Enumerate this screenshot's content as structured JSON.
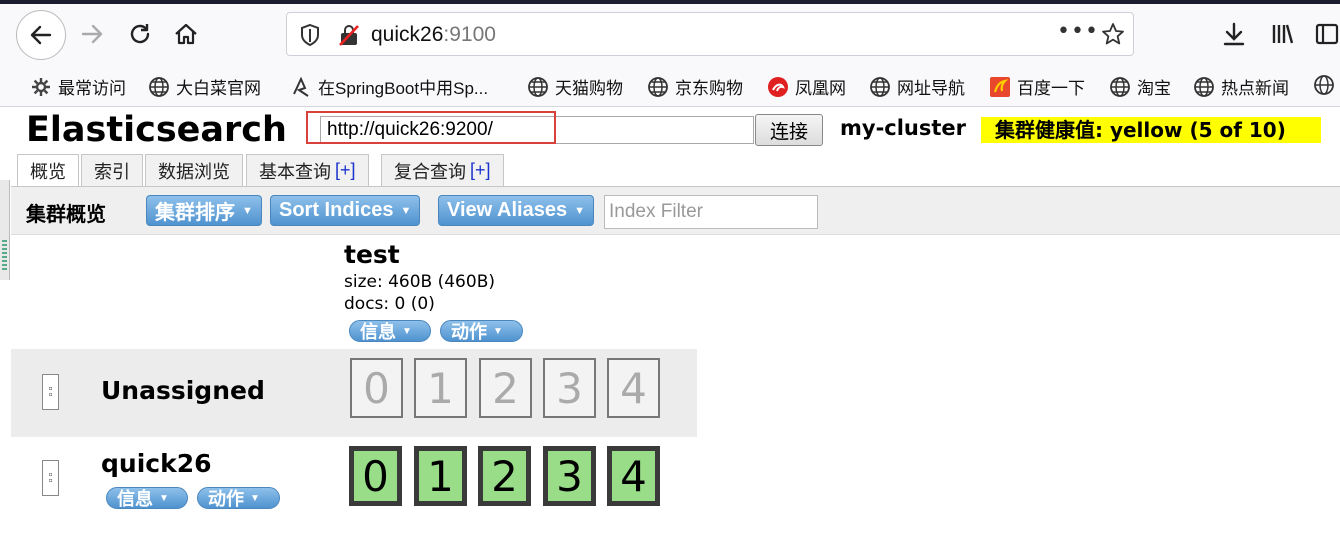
{
  "browser": {
    "url_host": "quick26",
    "url_port": ":9100",
    "bookmarks": [
      {
        "label": "最常访问",
        "icon": "gear-icon"
      },
      {
        "label": "大白菜官网",
        "icon": "globe-icon"
      },
      {
        "label": "在SpringBoot中用Sp...",
        "icon": "doc-icon"
      },
      {
        "label": "天猫购物",
        "icon": "globe-icon"
      },
      {
        "label": "京东购物",
        "icon": "globe-icon"
      },
      {
        "label": "凤凰网",
        "icon": "phoenix-icon"
      },
      {
        "label": "网址导航",
        "icon": "globe-icon"
      },
      {
        "label": "百度一下",
        "icon": "baidu-icon"
      },
      {
        "label": "淘宝",
        "icon": "globe-icon"
      },
      {
        "label": "热点新闻",
        "icon": "globe-icon"
      }
    ]
  },
  "header": {
    "title": "Elasticsearch",
    "connection_url": "http://quick26:9200/",
    "connect_label": "连接",
    "cluster_name": "my-cluster",
    "health": "集群健康值: yellow (5 of 10)",
    "health_color": "#ffff00"
  },
  "tabs": [
    {
      "label": "概览",
      "plus": ""
    },
    {
      "label": "索引",
      "plus": ""
    },
    {
      "label": "数据浏览",
      "plus": ""
    },
    {
      "label": "基本查询",
      "plus": "[+]"
    },
    {
      "label": "复合查询",
      "plus": "[+]"
    }
  ],
  "toolbar": {
    "title": "集群概览",
    "sort_cluster": "集群排序",
    "sort_indices": "Sort Indices",
    "view_aliases": "View Aliases",
    "filter_placeholder": "Index Filter"
  },
  "index": {
    "name": "test",
    "size": "size: 460B (460B)",
    "docs": "docs: 0 (0)",
    "info_label": "信息",
    "action_label": "动作"
  },
  "nodes": [
    {
      "name": "Unassigned",
      "shards": [
        "0",
        "1",
        "2",
        "3",
        "4"
      ],
      "state": "unassigned"
    },
    {
      "name": "quick26",
      "shards": [
        "0",
        "1",
        "2",
        "3",
        "4"
      ],
      "state": "started",
      "info_label": "信息",
      "action_label": "动作"
    }
  ],
  "colors": {
    "shard_started": "#99dd88",
    "button_blue": "#4f93d0",
    "highlight_red": "#d9403a"
  }
}
